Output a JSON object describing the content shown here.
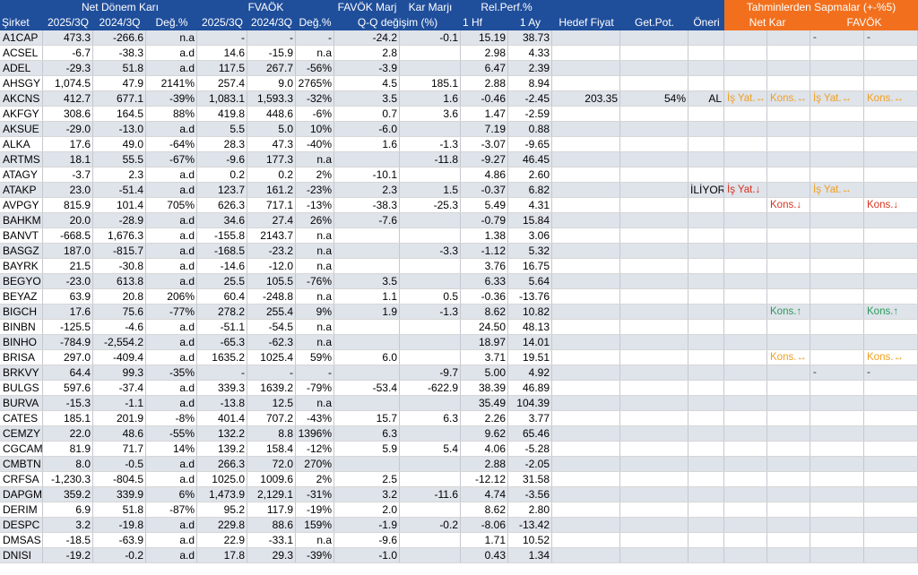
{
  "header": {
    "groups": [
      {
        "label": "",
        "style": "blue"
      },
      {
        "label": "Net Dönem Karı",
        "style": "blue"
      },
      {
        "label": "FVAÖK",
        "style": "blue"
      },
      {
        "label": "FAVÖK Marj",
        "style": "blue"
      },
      {
        "label": "Kar Marjı",
        "style": "blue"
      },
      {
        "label": "Rel.Perf.%",
        "style": "blue"
      },
      {
        "label": "",
        "style": "blue"
      },
      {
        "label": "Tahminlerden Sapmalar (+-%5)",
        "style": "orange"
      }
    ],
    "columns": [
      {
        "label": "Şirket"
      },
      {
        "label": "2025/3Q"
      },
      {
        "label": "2024/3Q"
      },
      {
        "label": "Değ.%"
      },
      {
        "label": "2025/3Q"
      },
      {
        "label": "2024/3Q"
      },
      {
        "label": "Değ.%"
      },
      {
        "label": "Q-Q değişim (%)"
      },
      {
        "label": "1 Hf"
      },
      {
        "label": "1 Ay"
      },
      {
        "label": "Hedef Fiyat"
      },
      {
        "label": "Get.Pot."
      },
      {
        "label": "Öneri"
      },
      {
        "label": "Net Kar"
      },
      {
        "label": "FAVÖK"
      }
    ]
  },
  "rows": [
    {
      "ticker": "A1CAP",
      "nk25": "473.3",
      "nk24": "-266.6",
      "nkd": "n.a",
      "fv25": "-",
      "fv24": "-",
      "fvd": "-",
      "fm": "-24.2",
      "km": "-0.1",
      "hf": "15.19",
      "ay": "38.73",
      "hedef": "",
      "pot": "",
      "oneri": "",
      "d1": "",
      "d1c": "",
      "d2": "",
      "d2c": "",
      "d3": "-",
      "d3c": "dash",
      "d4": "-",
      "d4c": "dash"
    },
    {
      "ticker": "ACSEL",
      "nk25": "-6.7",
      "nk24": "-38.3",
      "nkd": "a.d",
      "fv25": "14.6",
      "fv24": "-15.9",
      "fvd": "n.a",
      "fm": "2.8",
      "km": "",
      "hf": "2.98",
      "ay": "4.33",
      "hedef": "",
      "pot": "",
      "oneri": "",
      "d1": "",
      "d1c": "",
      "d2": "",
      "d2c": "",
      "d3": "",
      "d3c": "",
      "d4": "",
      "d4c": ""
    },
    {
      "ticker": "ADEL",
      "nk25": "-29.3",
      "nk24": "51.8",
      "nkd": "a.d",
      "fv25": "117.5",
      "fv24": "267.7",
      "fvd": "-56%",
      "fm": "-3.9",
      "km": "",
      "hf": "6.47",
      "ay": "2.39",
      "hedef": "",
      "pot": "",
      "oneri": "",
      "d1": "",
      "d1c": "",
      "d2": "",
      "d2c": "",
      "d3": "",
      "d3c": "",
      "d4": "",
      "d4c": ""
    },
    {
      "ticker": "AHSGY",
      "nk25": "1,074.5",
      "nk24": "47.9",
      "nkd": "2141%",
      "fv25": "257.4",
      "fv24": "9.0",
      "fvd": "2765%",
      "fm": "4.5",
      "km": "185.1",
      "hf": "2.88",
      "ay": "8.94",
      "hedef": "",
      "pot": "",
      "oneri": "",
      "d1": "",
      "d1c": "",
      "d2": "",
      "d2c": "",
      "d3": "",
      "d3c": "",
      "d4": "",
      "d4c": ""
    },
    {
      "ticker": "AKCNS",
      "nk25": "412.7",
      "nk24": "677.1",
      "nkd": "-39%",
      "fv25": "1,083.1",
      "fv24": "1,593.3",
      "fvd": "-32%",
      "fm": "3.5",
      "km": "1.6",
      "hf": "-0.46",
      "ay": "-2.45",
      "hedef": "203.35",
      "pot": "54%",
      "oneri": "AL",
      "d1": "İş Yat.↔",
      "d1c": "neutral",
      "d2": "Kons.↔",
      "d2c": "neutral",
      "d3": "İş Yat.↔",
      "d3c": "neutral",
      "d4": "Kons.↔",
      "d4c": "neutral"
    },
    {
      "ticker": "AKFGY",
      "nk25": "308.6",
      "nk24": "164.5",
      "nkd": "88%",
      "fv25": "419.8",
      "fv24": "448.6",
      "fvd": "-6%",
      "fm": "0.7",
      "km": "3.6",
      "hf": "1.47",
      "ay": "-2.59",
      "hedef": "",
      "pot": "",
      "oneri": "",
      "d1": "",
      "d1c": "",
      "d2": "",
      "d2c": "",
      "d3": "",
      "d3c": "",
      "d4": "",
      "d4c": ""
    },
    {
      "ticker": "AKSUE",
      "nk25": "-29.0",
      "nk24": "-13.0",
      "nkd": "a.d",
      "fv25": "5.5",
      "fv24": "5.0",
      "fvd": "10%",
      "fm": "-6.0",
      "km": "",
      "hf": "7.19",
      "ay": "0.88",
      "hedef": "",
      "pot": "",
      "oneri": "",
      "d1": "",
      "d1c": "",
      "d2": "",
      "d2c": "",
      "d3": "",
      "d3c": "",
      "d4": "",
      "d4c": ""
    },
    {
      "ticker": "ALKA",
      "nk25": "17.6",
      "nk24": "49.0",
      "nkd": "-64%",
      "fv25": "28.3",
      "fv24": "47.3",
      "fvd": "-40%",
      "fm": "1.6",
      "km": "-1.3",
      "hf": "-3.07",
      "ay": "-9.65",
      "hedef": "",
      "pot": "",
      "oneri": "",
      "d1": "",
      "d1c": "",
      "d2": "",
      "d2c": "",
      "d3": "",
      "d3c": "",
      "d4": "",
      "d4c": ""
    },
    {
      "ticker": "ARTMS",
      "nk25": "18.1",
      "nk24": "55.5",
      "nkd": "-67%",
      "fv25": "-9.6",
      "fv24": "177.3",
      "fvd": "n.a",
      "fm": "",
      "km": "-11.8",
      "hf": "-9.27",
      "ay": "46.45",
      "hedef": "",
      "pot": "",
      "oneri": "",
      "d1": "",
      "d1c": "",
      "d2": "",
      "d2c": "",
      "d3": "",
      "d3c": "",
      "d4": "",
      "d4c": ""
    },
    {
      "ticker": "ATAGY",
      "nk25": "-3.7",
      "nk24": "2.3",
      "nkd": "a.d",
      "fv25": "0.2",
      "fv24": "0.2",
      "fvd": "2%",
      "fm": "-10.1",
      "km": "",
      "hf": "4.86",
      "ay": "2.60",
      "hedef": "",
      "pot": "",
      "oneri": "",
      "d1": "",
      "d1c": "",
      "d2": "",
      "d2c": "",
      "d3": "",
      "d3c": "",
      "d4": "",
      "d4c": ""
    },
    {
      "ticker": "ATAKP",
      "nk25": "23.0",
      "nk24": "-51.4",
      "nkd": "a.d",
      "fv25": "123.7",
      "fv24": "161.2",
      "fvd": "-23%",
      "fm": "2.3",
      "km": "1.5",
      "hf": "-0.37",
      "ay": "6.82",
      "hedef": "",
      "pot": "",
      "oneri": "İLİYOR",
      "d1": "İş Yat.↓",
      "d1c": "down",
      "d2": "",
      "d2c": "",
      "d3": "İş Yat.↔",
      "d3c": "neutral",
      "d4": "",
      "d4c": ""
    },
    {
      "ticker": "AVPGY",
      "nk25": "815.9",
      "nk24": "101.4",
      "nkd": "705%",
      "fv25": "626.3",
      "fv24": "717.1",
      "fvd": "-13%",
      "fm": "-38.3",
      "km": "-25.3",
      "hf": "5.49",
      "ay": "4.31",
      "hedef": "",
      "pot": "",
      "oneri": "",
      "d1": "",
      "d1c": "",
      "d2": "Kons.↓",
      "d2c": "down",
      "d3": "",
      "d3c": "",
      "d4": "Kons.↓",
      "d4c": "down"
    },
    {
      "ticker": "BAHKM",
      "nk25": "20.0",
      "nk24": "-28.9",
      "nkd": "a.d",
      "fv25": "34.6",
      "fv24": "27.4",
      "fvd": "26%",
      "fm": "-7.6",
      "km": "",
      "hf": "-0.79",
      "ay": "15.84",
      "hedef": "",
      "pot": "",
      "oneri": "",
      "d1": "",
      "d1c": "",
      "d2": "",
      "d2c": "",
      "d3": "",
      "d3c": "",
      "d4": "",
      "d4c": ""
    },
    {
      "ticker": "BANVT",
      "nk25": "-668.5",
      "nk24": "1,676.3",
      "nkd": "a.d",
      "fv25": "-155.8",
      "fv24": "2143.7",
      "fvd": "n.a",
      "fm": "",
      "km": "",
      "hf": "1.38",
      "ay": "3.06",
      "hedef": "",
      "pot": "",
      "oneri": "",
      "d1": "",
      "d1c": "",
      "d2": "",
      "d2c": "",
      "d3": "",
      "d3c": "",
      "d4": "",
      "d4c": ""
    },
    {
      "ticker": "BASGZ",
      "nk25": "187.0",
      "nk24": "-815.7",
      "nkd": "a.d",
      "fv25": "-168.5",
      "fv24": "-23.2",
      "fvd": "n.a",
      "fm": "",
      "km": "-3.3",
      "hf": "-1.12",
      "ay": "5.32",
      "hedef": "",
      "pot": "",
      "oneri": "",
      "d1": "",
      "d1c": "",
      "d2": "",
      "d2c": "",
      "d3": "",
      "d3c": "",
      "d4": "",
      "d4c": ""
    },
    {
      "ticker": "BAYRK",
      "nk25": "21.5",
      "nk24": "-30.8",
      "nkd": "a.d",
      "fv25": "-14.6",
      "fv24": "-12.0",
      "fvd": "n.a",
      "fm": "",
      "km": "",
      "hf": "3.76",
      "ay": "16.75",
      "hedef": "",
      "pot": "",
      "oneri": "",
      "d1": "",
      "d1c": "",
      "d2": "",
      "d2c": "",
      "d3": "",
      "d3c": "",
      "d4": "",
      "d4c": ""
    },
    {
      "ticker": "BEGYO",
      "nk25": "-23.0",
      "nk24": "613.8",
      "nkd": "a.d",
      "fv25": "25.5",
      "fv24": "105.5",
      "fvd": "-76%",
      "fm": "3.5",
      "km": "",
      "hf": "6.33",
      "ay": "5.64",
      "hedef": "",
      "pot": "",
      "oneri": "",
      "d1": "",
      "d1c": "",
      "d2": "",
      "d2c": "",
      "d3": "",
      "d3c": "",
      "d4": "",
      "d4c": ""
    },
    {
      "ticker": "BEYAZ",
      "nk25": "63.9",
      "nk24": "20.8",
      "nkd": "206%",
      "fv25": "60.4",
      "fv24": "-248.8",
      "fvd": "n.a",
      "fm": "1.1",
      "km": "0.5",
      "hf": "-0.36",
      "ay": "-13.76",
      "hedef": "",
      "pot": "",
      "oneri": "",
      "d1": "",
      "d1c": "",
      "d2": "",
      "d2c": "",
      "d3": "",
      "d3c": "",
      "d4": "",
      "d4c": ""
    },
    {
      "ticker": "BIGCH",
      "nk25": "17.6",
      "nk24": "75.6",
      "nkd": "-77%",
      "fv25": "278.2",
      "fv24": "255.4",
      "fvd": "9%",
      "fm": "1.9",
      "km": "-1.3",
      "hf": "8.62",
      "ay": "10.82",
      "hedef": "",
      "pot": "",
      "oneri": "",
      "d1": "",
      "d1c": "",
      "d2": "Kons.↑",
      "d2c": "up",
      "d3": "",
      "d3c": "",
      "d4": "Kons.↑",
      "d4c": "up"
    },
    {
      "ticker": "BINBN",
      "nk25": "-125.5",
      "nk24": "-4.6",
      "nkd": "a.d",
      "fv25": "-51.1",
      "fv24": "-54.5",
      "fvd": "n.a",
      "fm": "",
      "km": "",
      "hf": "24.50",
      "ay": "48.13",
      "hedef": "",
      "pot": "",
      "oneri": "",
      "d1": "",
      "d1c": "",
      "d2": "",
      "d2c": "",
      "d3": "",
      "d3c": "",
      "d4": "",
      "d4c": ""
    },
    {
      "ticker": "BINHO",
      "nk25": "-784.9",
      "nk24": "-2,554.2",
      "nkd": "a.d",
      "fv25": "-65.3",
      "fv24": "-62.3",
      "fvd": "n.a",
      "fm": "",
      "km": "",
      "hf": "18.97",
      "ay": "14.01",
      "hedef": "",
      "pot": "",
      "oneri": "",
      "d1": "",
      "d1c": "",
      "d2": "",
      "d2c": "",
      "d3": "",
      "d3c": "",
      "d4": "",
      "d4c": ""
    },
    {
      "ticker": "BRISA",
      "nk25": "297.0",
      "nk24": "-409.4",
      "nkd": "a.d",
      "fv25": "1635.2",
      "fv24": "1025.4",
      "fvd": "59%",
      "fm": "6.0",
      "km": "",
      "hf": "3.71",
      "ay": "19.51",
      "hedef": "",
      "pot": "",
      "oneri": "",
      "d1": "",
      "d1c": "",
      "d2": "Kons.↔",
      "d2c": "neutral",
      "d3": "",
      "d3c": "",
      "d4": "Kons.↔",
      "d4c": "neutral"
    },
    {
      "ticker": "BRKVY",
      "nk25": "64.4",
      "nk24": "99.3",
      "nkd": "-35%",
      "fv25": "-",
      "fv24": "-",
      "fvd": "-",
      "fm": "",
      "km": "-9.7",
      "hf": "5.00",
      "ay": "4.92",
      "hedef": "",
      "pot": "",
      "oneri": "",
      "d1": "",
      "d1c": "",
      "d2": "",
      "d2c": "",
      "d3": "-",
      "d3c": "dash",
      "d4": "-",
      "d4c": "dash"
    },
    {
      "ticker": "BULGS",
      "nk25": "597.6",
      "nk24": "-37.4",
      "nkd": "a.d",
      "fv25": "339.3",
      "fv24": "1639.2",
      "fvd": "-79%",
      "fm": "-53.4",
      "km": "-622.9",
      "hf": "38.39",
      "ay": "46.89",
      "hedef": "",
      "pot": "",
      "oneri": "",
      "d1": "",
      "d1c": "",
      "d2": "",
      "d2c": "",
      "d3": "",
      "d3c": "",
      "d4": "",
      "d4c": ""
    },
    {
      "ticker": "BURVA",
      "nk25": "-15.3",
      "nk24": "-1.1",
      "nkd": "a.d",
      "fv25": "-13.8",
      "fv24": "12.5",
      "fvd": "n.a",
      "fm": "",
      "km": "",
      "hf": "35.49",
      "ay": "104.39",
      "hedef": "",
      "pot": "",
      "oneri": "",
      "d1": "",
      "d1c": "",
      "d2": "",
      "d2c": "",
      "d3": "",
      "d3c": "",
      "d4": "",
      "d4c": ""
    },
    {
      "ticker": "CATES",
      "nk25": "185.1",
      "nk24": "201.9",
      "nkd": "-8%",
      "fv25": "401.4",
      "fv24": "707.2",
      "fvd": "-43%",
      "fm": "15.7",
      "km": "6.3",
      "hf": "2.26",
      "ay": "3.77",
      "hedef": "",
      "pot": "",
      "oneri": "",
      "d1": "",
      "d1c": "",
      "d2": "",
      "d2c": "",
      "d3": "",
      "d3c": "",
      "d4": "",
      "d4c": ""
    },
    {
      "ticker": "CEMZY",
      "nk25": "22.0",
      "nk24": "48.6",
      "nkd": "-55%",
      "fv25": "132.2",
      "fv24": "8.8",
      "fvd": "1396%",
      "fm": "6.3",
      "km": "",
      "hf": "9.62",
      "ay": "65.46",
      "hedef": "",
      "pot": "",
      "oneri": "",
      "d1": "",
      "d1c": "",
      "d2": "",
      "d2c": "",
      "d3": "",
      "d3c": "",
      "d4": "",
      "d4c": ""
    },
    {
      "ticker": "CGCAM",
      "nk25": "81.9",
      "nk24": "71.7",
      "nkd": "14%",
      "fv25": "139.2",
      "fv24": "158.4",
      "fvd": "-12%",
      "fm": "5.9",
      "km": "5.4",
      "hf": "4.06",
      "ay": "-5.28",
      "hedef": "",
      "pot": "",
      "oneri": "",
      "d1": "",
      "d1c": "",
      "d2": "",
      "d2c": "",
      "d3": "",
      "d3c": "",
      "d4": "",
      "d4c": ""
    },
    {
      "ticker": "CMBTN",
      "nk25": "8.0",
      "nk24": "-0.5",
      "nkd": "a.d",
      "fv25": "266.3",
      "fv24": "72.0",
      "fvd": "270%",
      "fm": "",
      "km": "",
      "hf": "2.88",
      "ay": "-2.05",
      "hedef": "",
      "pot": "",
      "oneri": "",
      "d1": "",
      "d1c": "",
      "d2": "",
      "d2c": "",
      "d3": "",
      "d3c": "",
      "d4": "",
      "d4c": ""
    },
    {
      "ticker": "CRFSA",
      "nk25": "-1,230.3",
      "nk24": "-804.5",
      "nkd": "a.d",
      "fv25": "1025.0",
      "fv24": "1009.6",
      "fvd": "2%",
      "fm": "2.5",
      "km": "",
      "hf": "-12.12",
      "ay": "31.58",
      "hedef": "",
      "pot": "",
      "oneri": "",
      "d1": "",
      "d1c": "",
      "d2": "",
      "d2c": "",
      "d3": "",
      "d3c": "",
      "d4": "",
      "d4c": ""
    },
    {
      "ticker": "DAPGM",
      "nk25": "359.2",
      "nk24": "339.9",
      "nkd": "6%",
      "fv25": "1,473.9",
      "fv24": "2,129.1",
      "fvd": "-31%",
      "fm": "3.2",
      "km": "-11.6",
      "hf": "4.74",
      "ay": "-3.56",
      "hedef": "",
      "pot": "",
      "oneri": "",
      "d1": "",
      "d1c": "",
      "d2": "",
      "d2c": "",
      "d3": "",
      "d3c": "",
      "d4": "",
      "d4c": ""
    },
    {
      "ticker": "DERIM",
      "nk25": "6.9",
      "nk24": "51.8",
      "nkd": "-87%",
      "fv25": "95.2",
      "fv24": "117.9",
      "fvd": "-19%",
      "fm": "2.0",
      "km": "",
      "hf": "8.62",
      "ay": "2.80",
      "hedef": "",
      "pot": "",
      "oneri": "",
      "d1": "",
      "d1c": "",
      "d2": "",
      "d2c": "",
      "d3": "",
      "d3c": "",
      "d4": "",
      "d4c": ""
    },
    {
      "ticker": "DESPC",
      "nk25": "3.2",
      "nk24": "-19.8",
      "nkd": "a.d",
      "fv25": "229.8",
      "fv24": "88.6",
      "fvd": "159%",
      "fm": "-1.9",
      "km": "-0.2",
      "hf": "-8.06",
      "ay": "-13.42",
      "hedef": "",
      "pot": "",
      "oneri": "",
      "d1": "",
      "d1c": "",
      "d2": "",
      "d2c": "",
      "d3": "",
      "d3c": "",
      "d4": "",
      "d4c": ""
    },
    {
      "ticker": "DMSAS",
      "nk25": "-18.5",
      "nk24": "-63.9",
      "nkd": "a.d",
      "fv25": "22.9",
      "fv24": "-33.1",
      "fvd": "n.a",
      "fm": "-9.6",
      "km": "",
      "hf": "1.71",
      "ay": "10.52",
      "hedef": "",
      "pot": "",
      "oneri": "",
      "d1": "",
      "d1c": "",
      "d2": "",
      "d2c": "",
      "d3": "",
      "d3c": "",
      "d4": "",
      "d4c": ""
    },
    {
      "ticker": "DNISI",
      "nk25": "-19.2",
      "nk24": "-0.2",
      "nkd": "a.d",
      "fv25": "17.8",
      "fv24": "29.3",
      "fvd": "-39%",
      "fm": "-1.0",
      "km": "",
      "hf": "0.43",
      "ay": "1.34",
      "hedef": "",
      "pot": "",
      "oneri": "",
      "d1": "",
      "d1c": "",
      "d2": "",
      "d2c": "",
      "d3": "",
      "d3c": "",
      "d4": "",
      "d4c": ""
    }
  ],
  "colors": {
    "header_blue": "#1f4e9b",
    "header_orange": "#f2701d",
    "row_shade": "#dfe3ea",
    "dev_up": "#2a9a5a",
    "dev_down": "#d9321f",
    "dev_neutral": "#f0a01e"
  }
}
